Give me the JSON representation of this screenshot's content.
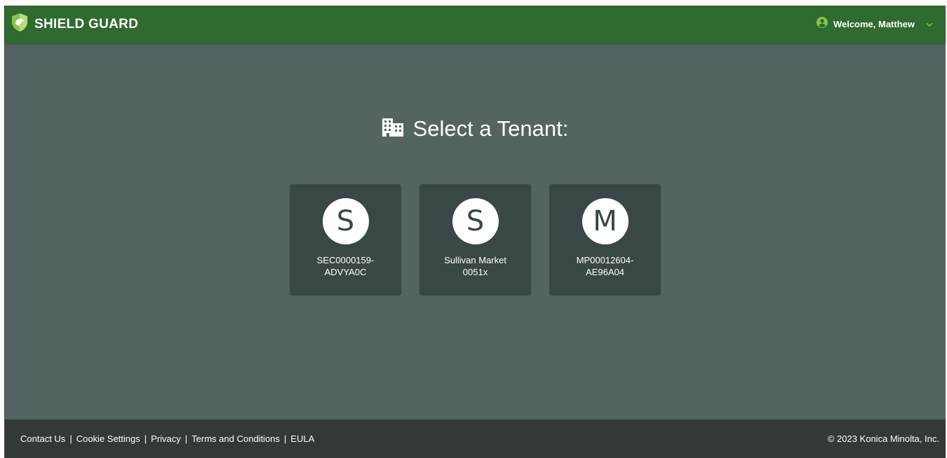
{
  "header": {
    "brand": "SHIELD GUARD",
    "welcome": "Welcome, Matthew"
  },
  "main": {
    "title": "Select a Tenant:",
    "tenants": [
      {
        "initial": "S",
        "line1": "SEC0000159-",
        "line2": "ADVYA0C"
      },
      {
        "initial": "S",
        "line1": "Sullivan Market",
        "line2": "0051x"
      },
      {
        "initial": "M",
        "line1": "MP00012604-",
        "line2": "AE96A04"
      }
    ]
  },
  "footer": {
    "links": [
      "Contact Us",
      "Cookie Settings",
      "Privacy",
      "Terms and Conditions",
      "EULA"
    ],
    "separator": "|",
    "copyright": "© 2023 Konica Minolta, Inc."
  },
  "colors": {
    "header_bg": "#2f6a2e",
    "page_bg": "#536462",
    "tile_bg": "#394746",
    "footer_bg": "#333938",
    "accent_green": "#8bc34a"
  },
  "icons": {
    "brand": "shield-logo-icon",
    "user": "user-circle-icon",
    "dropdown": "chevron-down-icon",
    "heading": "building-icon"
  }
}
